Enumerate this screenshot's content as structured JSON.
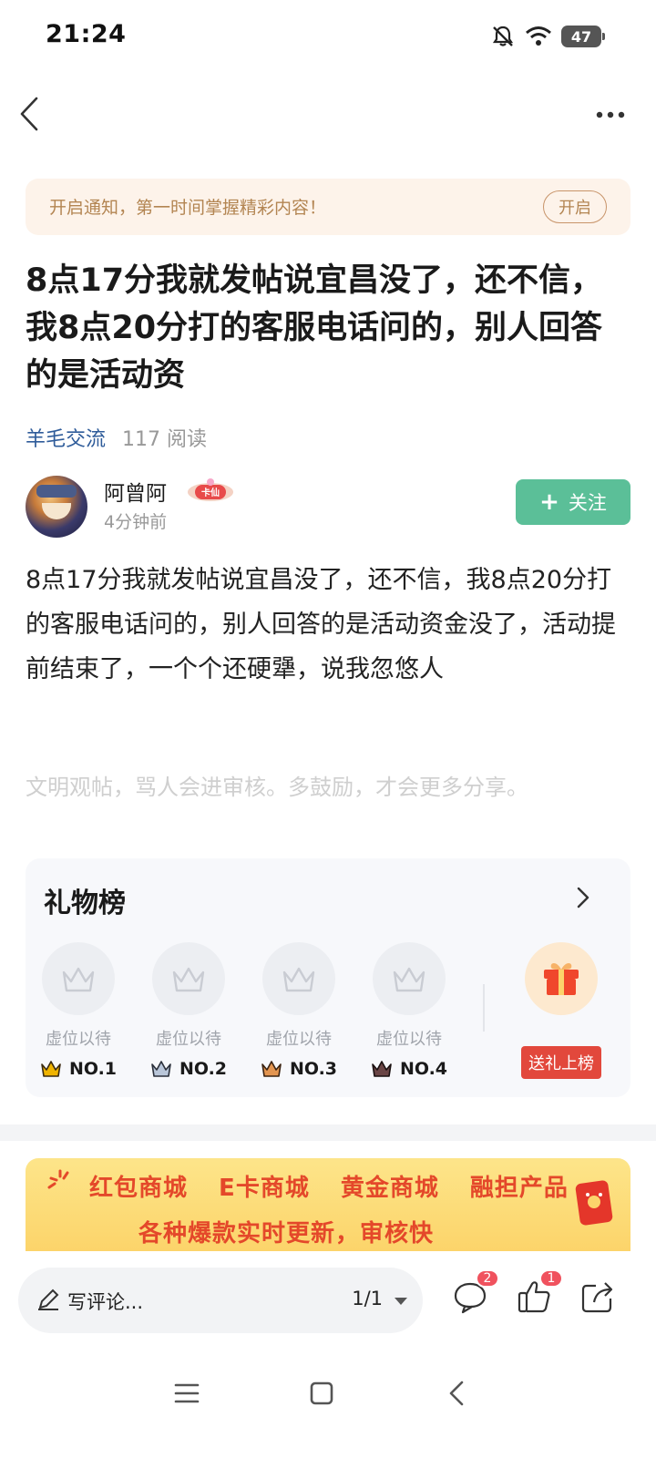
{
  "status_bar": {
    "time": "21:24",
    "battery": "47",
    "icons": [
      "bell-off-icon",
      "wifi-icon",
      "battery-icon"
    ]
  },
  "nav": {
    "back_icon": "back-arrow-icon",
    "more_icon": "more-dots-icon"
  },
  "notice": {
    "text": "开启通知，第一时间掌握精彩内容！",
    "button": "开启"
  },
  "post": {
    "title": "8点17分我就发帖说宜昌没了，还不信，我8点20分打的客服电话问的，别人回答的是活动资",
    "forum": "羊毛交流",
    "reads": "117 阅读",
    "author": {
      "name": "阿曾阿",
      "badge": "卡仙",
      "time": "4分钟前"
    },
    "follow_label": "关注",
    "body": "8点17分我就发帖说宜昌没了，还不信，我8点20分打的客服电话问的，别人回答的是活动资金没了，活动提前结束了，一个个还硬犟，说我忽悠人",
    "civility_tip": "文明观帖，骂人会进审核。多鼓励，才会更多分享。"
  },
  "gift_board": {
    "title": "礼物榜",
    "slots": [
      {
        "label": "虚位以待",
        "rank": "NO.1",
        "crown_color": "#f0b400"
      },
      {
        "label": "虚位以待",
        "rank": "NO.2",
        "crown_color": "#8a9bb5"
      },
      {
        "label": "虚位以待",
        "rank": "NO.3",
        "crown_color": "#d8843c"
      },
      {
        "label": "虚位以待",
        "rank": "NO.4",
        "crown_color": "#5a3a3a"
      }
    ],
    "send_label": "送礼上榜"
  },
  "banner": {
    "line1": "红包商城 E卡商城 黄金商城 融担产品",
    "line2": "各种爆款实时更新，审核快"
  },
  "bottom_bar": {
    "comment_placeholder": "写评论...",
    "page": "1/1",
    "comment_count": "2",
    "like_count": "1"
  },
  "colors": {
    "accent_green": "#5bbf98",
    "forum_blue": "#2f5c9a",
    "notice_bg": "#fdf3ea",
    "badge_red": "#f0525e",
    "send_red": "#e2483c"
  }
}
